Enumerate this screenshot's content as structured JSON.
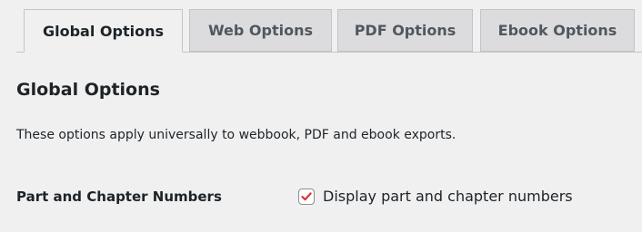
{
  "tabs": [
    {
      "label": "Global Options",
      "active": true
    },
    {
      "label": "Web Options",
      "active": false
    },
    {
      "label": "PDF Options",
      "active": false
    },
    {
      "label": "Ebook Options",
      "active": false
    }
  ],
  "section": {
    "title": "Global Options",
    "description": "These options apply universally to webbook, PDF and ebook exports."
  },
  "fields": [
    {
      "label": "Part and Chapter Numbers",
      "checkbox_label": "Display part and chapter numbers",
      "checked": true
    }
  ],
  "colors": {
    "check_mark": "#d63638",
    "active_tab_bg": "#f0f0f1",
    "inactive_tab_bg": "#dcdcde",
    "border": "#c3c4c7"
  },
  "icons": {
    "checkbox_checked": "checkmark-icon"
  }
}
